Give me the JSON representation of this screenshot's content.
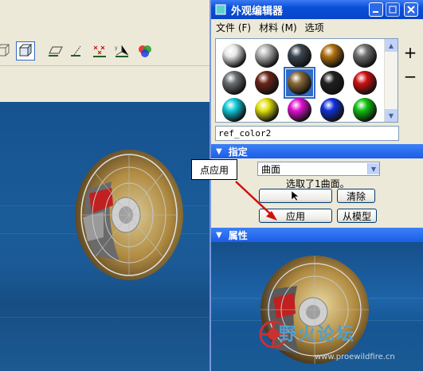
{
  "editor": {
    "title": "外观编辑器",
    "menu": [
      "文件 (F)",
      "材料 (M)",
      "选项"
    ],
    "side_plus": "+",
    "side_minus": "−",
    "material_name": "ref_color2",
    "swatch_colors": [
      [
        "#e8e8e8",
        "#b0b0b0",
        "#3a4650",
        "#b07010",
        "#707070"
      ],
      [
        "#6a6e72",
        "#6a2418",
        "#8a6a38",
        "#202020",
        "#d01010"
      ],
      [
        "#10c8d8",
        "#e0e010",
        "#e010d0",
        "#1030d8",
        "#10c010"
      ]
    ]
  },
  "assign": {
    "header": "指定",
    "surface_option": "曲面",
    "selected_status": "选取了1曲面。",
    "clear_label": "清除",
    "apply_label": "应用",
    "from_model_label": "从模型"
  },
  "properties": {
    "header": "属性"
  },
  "callout": {
    "text": "点应用"
  },
  "watermark": {
    "text": "野火论坛",
    "url": "www.proewildfire.cn"
  },
  "colors": {
    "accent": "#0a4fd8",
    "viewport": "#1a5c99",
    "arrow": "#d01010"
  }
}
